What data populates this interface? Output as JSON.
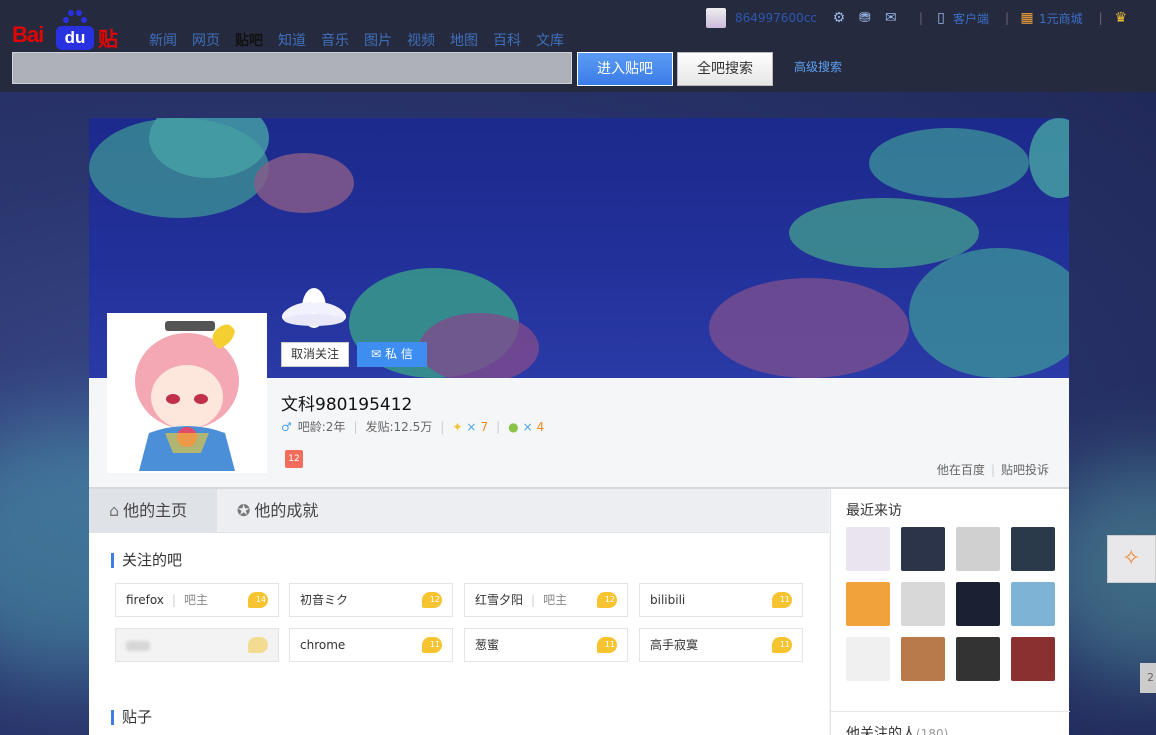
{
  "header": {
    "logo": {
      "bai": "Bai",
      "du": "du",
      "tieba": "贴吧"
    },
    "nav": [
      "新闻",
      "网页",
      "贴吧",
      "知道",
      "音乐",
      "图片",
      "视频",
      "地图",
      "百科",
      "文库"
    ],
    "nav_active": "贴吧",
    "search": {
      "value": "",
      "enter_label": "进入贴吧",
      "all_label": "全吧搜索",
      "advanced": "高级搜索"
    },
    "user": {
      "name": "864997600cc",
      "client": "客户端",
      "shop": "1元商城"
    }
  },
  "profile": {
    "unfollow_label": "取消关注",
    "message_label": "私 信",
    "username": "文科980195412",
    "age_label": "吧龄:2年",
    "posts_label": "发贴:12.5万",
    "gem_count": "7",
    "bean_count": "4",
    "mult": "×",
    "badge": "12",
    "link_baidu": "他在百度",
    "link_report": "贴吧投诉"
  },
  "tabs": [
    "他的主页",
    "他的成就"
  ],
  "followed_bars": {
    "title": "关注的吧",
    "items": [
      {
        "name": "firefox",
        "role": "吧主",
        "level": "14"
      },
      {
        "name": "初音ミク",
        "role": "",
        "level": "12"
      },
      {
        "name": "红雪夕阳",
        "role": "吧主",
        "level": "12"
      },
      {
        "name": "bilibili",
        "role": "",
        "level": "11"
      },
      {
        "name": "",
        "role": "",
        "level": ""
      },
      {
        "name": "chrome",
        "role": "",
        "level": "11"
      },
      {
        "name": "葱蜜",
        "role": "",
        "level": "11"
      },
      {
        "name": "高手寂寞",
        "role": "",
        "level": "11"
      }
    ]
  },
  "posts_title": "贴子",
  "recent_visitors": {
    "title": "最近来访",
    "colors": [
      "#e9e4ef",
      "#2b3448",
      "#d0d0d0",
      "#2a3a4a",
      "#f2a23a",
      "#d8d8d8",
      "#1b2133",
      "#7fb3d6",
      "#f0f0f0",
      "#b87a4a",
      "#333",
      "#8a3030"
    ]
  },
  "following": {
    "title": "他关注的人",
    "count": "(180)"
  },
  "float_num": "2"
}
